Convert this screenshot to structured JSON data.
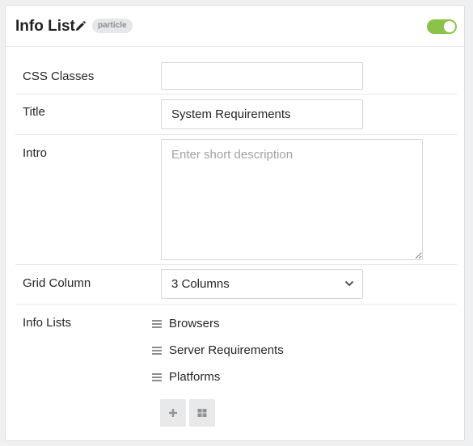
{
  "header": {
    "title": "Info List",
    "badge": "particle",
    "enabled": true
  },
  "fields": {
    "css_classes": {
      "label": "CSS Classes",
      "value": ""
    },
    "title": {
      "label": "Title",
      "value": "System Requirements"
    },
    "intro": {
      "label": "Intro",
      "value": "",
      "placeholder": "Enter short description"
    },
    "grid_column": {
      "label": "Grid Column",
      "value": "3 Columns"
    },
    "info_lists": {
      "label": "Info Lists",
      "items": [
        "Browsers",
        "Server Requirements",
        "Platforms"
      ]
    }
  },
  "colors": {
    "toggle_on": "#8bc34a",
    "border": "#d3d6da",
    "button_bg": "#e8e9eb"
  },
  "icons": {
    "edit": "pencil-icon",
    "drag": "drag-handle-icon",
    "add": "plus-icon",
    "collection": "grid-icon",
    "dropdown": "chevron-down-icon"
  }
}
